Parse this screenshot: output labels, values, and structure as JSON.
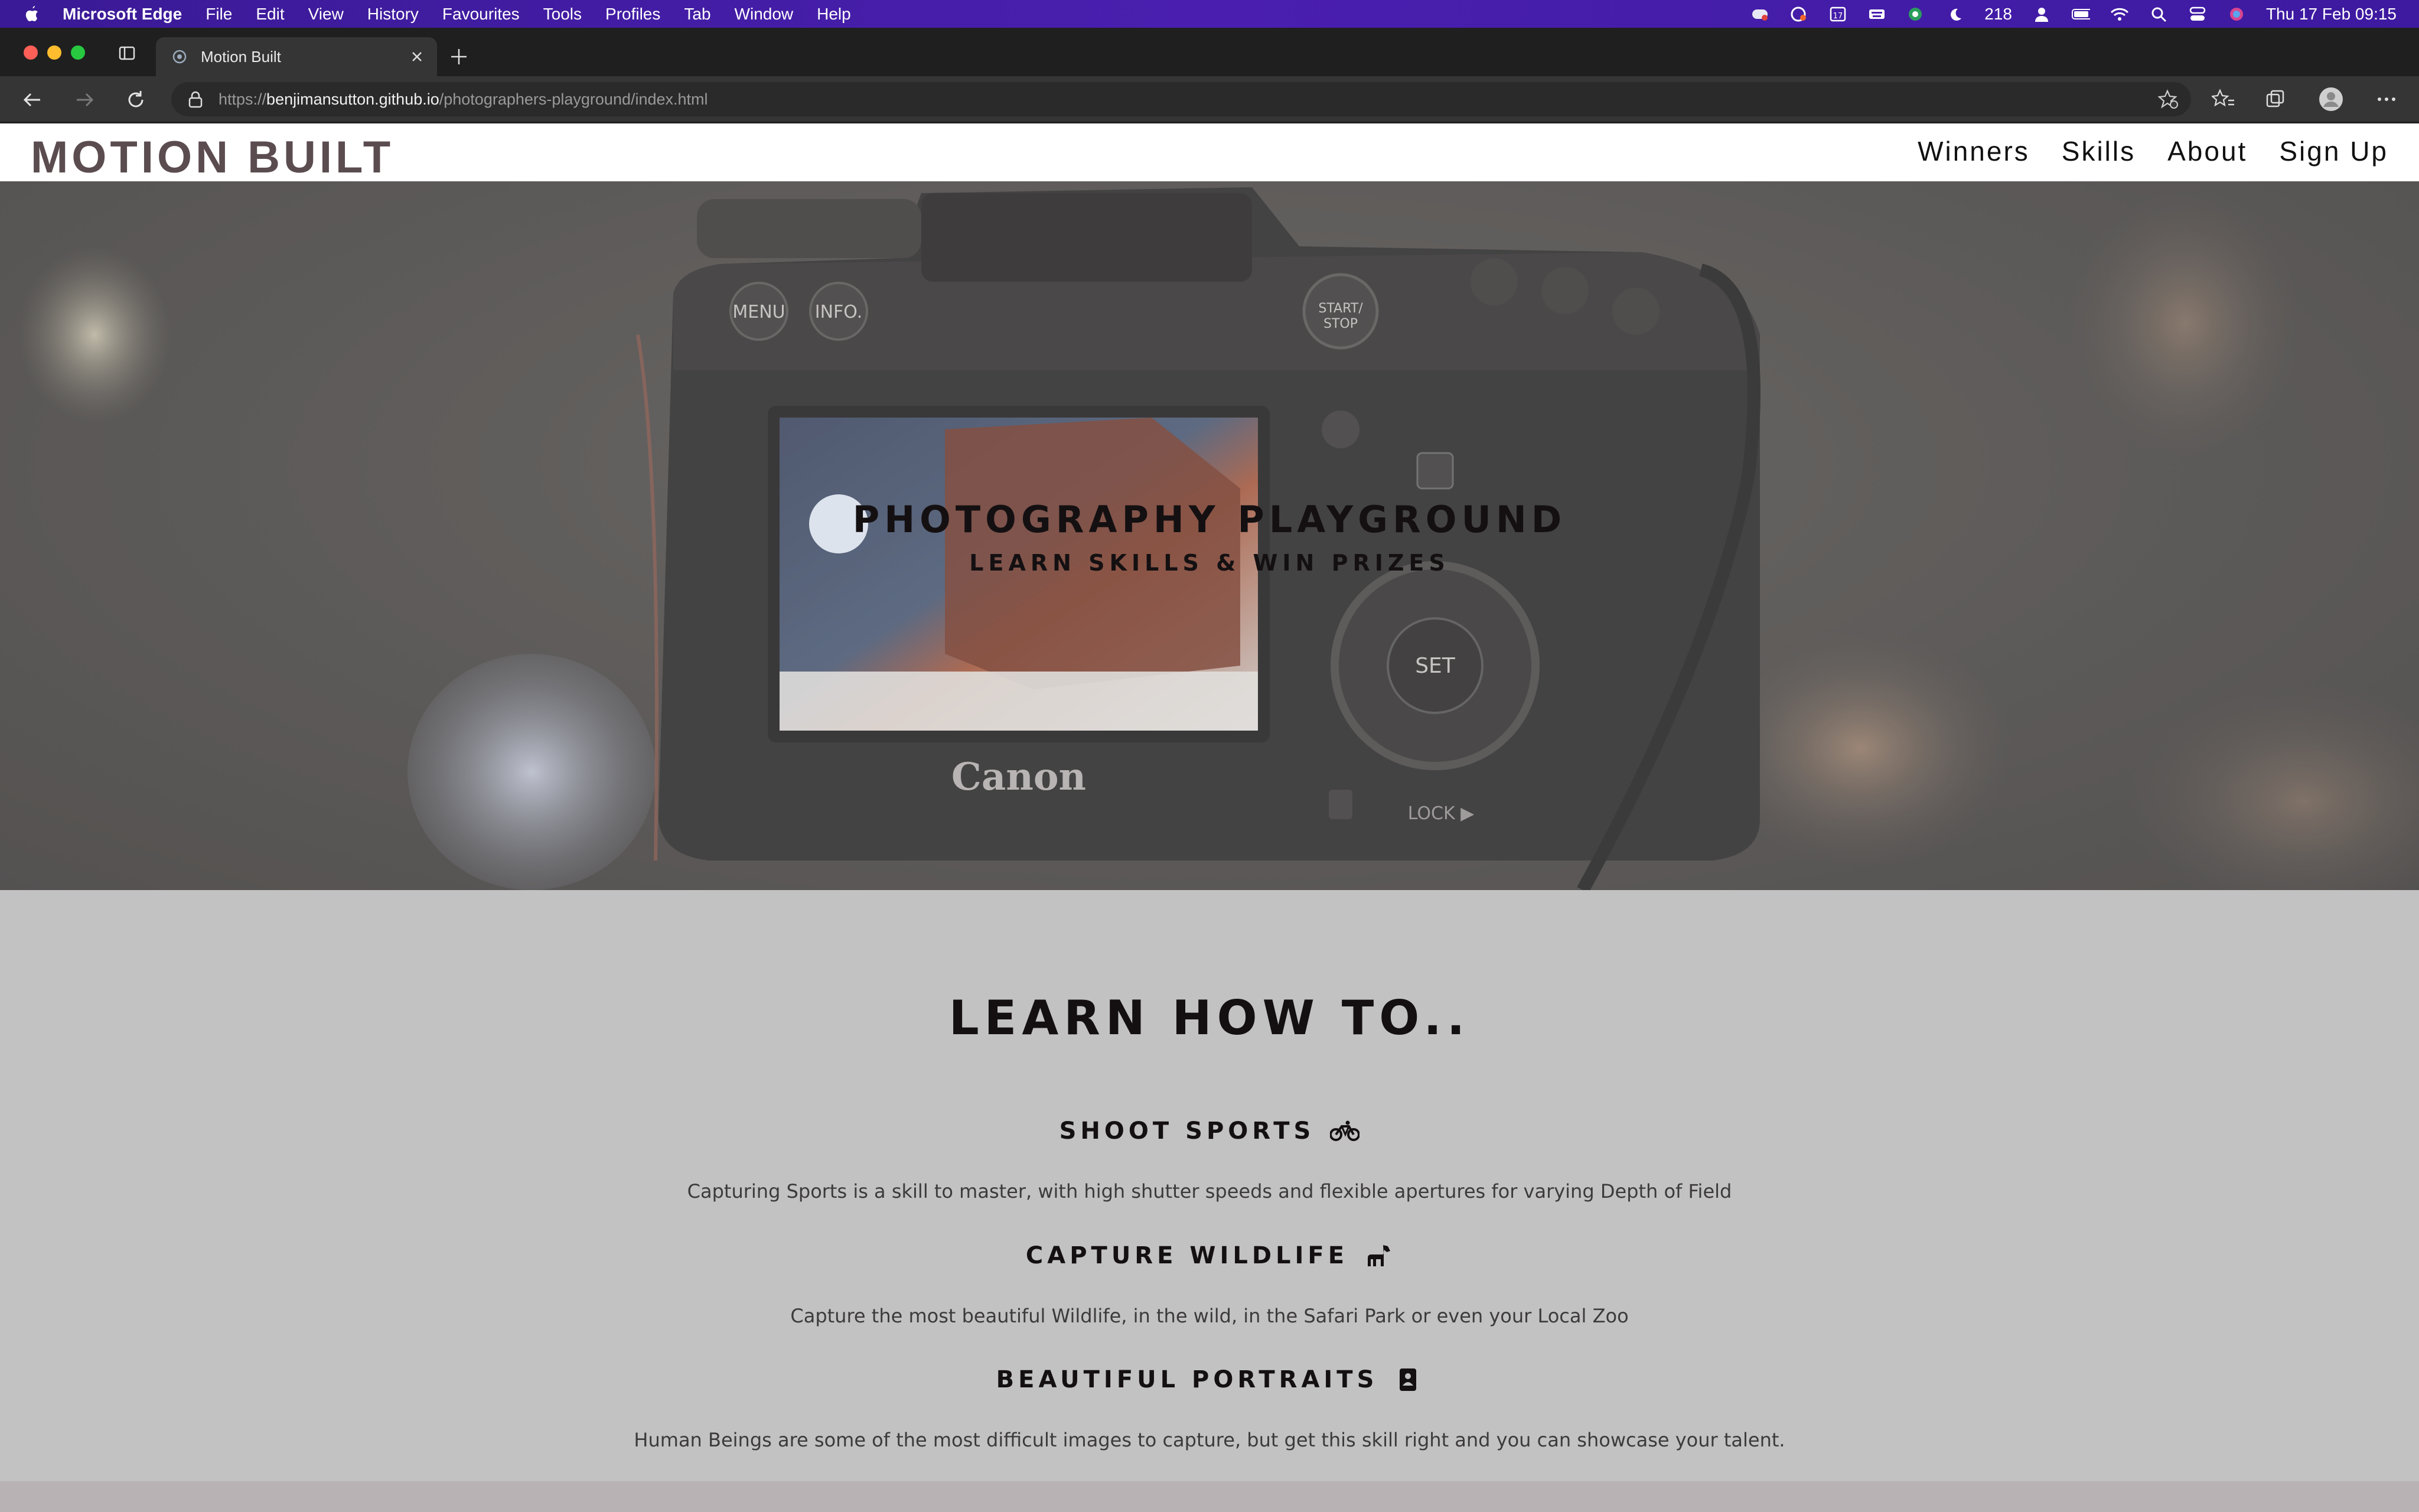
{
  "menubar": {
    "app_name": "Microsoft Edge",
    "items": [
      "File",
      "Edit",
      "View",
      "History",
      "Favourites",
      "Tools",
      "Profiles",
      "Tab",
      "Window",
      "Help"
    ],
    "battery_moon_count": "218",
    "datetime": "Thu 17 Feb  09:15"
  },
  "browser": {
    "tab_title": "Motion Built",
    "url_scheme": "https://",
    "url_host": "benjimansutton.github.io",
    "url_path": "/photographers-playground/index.html"
  },
  "site": {
    "brand": "MOTION BUILT",
    "nav": [
      "Winners",
      "Skills",
      "About",
      "Sign Up"
    ],
    "hero": {
      "title": "PHOTOGRAPHY PLAYGROUND",
      "subtitle": "LEARN SKILLS & WIN PRIZES",
      "camera_labels": {
        "menu": "MENU",
        "info": "INFO.",
        "set": "SET",
        "brand": "Canon",
        "start_stop": "START/ STOP",
        "lock": "LOCK ▶"
      }
    },
    "learn": {
      "title": "LEARN HOW TO..",
      "skills": [
        {
          "heading": "SHOOT SPORTS",
          "icon": "bicycle-icon",
          "description": "Capturing Sports is a skill to master, with high shutter speeds and flexible apertures for varying Depth of Field"
        },
        {
          "heading": "CAPTURE WILDLIFE",
          "icon": "horse-icon",
          "description": "Capture the most beautiful Wildlife, in the wild, in the Safari Park or even your Local Zoo"
        },
        {
          "heading": "BEAUTIFUL PORTRAITS",
          "icon": "portrait-icon",
          "description": "Human Beings are some of the most difficult images to capture, but get this skill right and you can showcase your talent."
        }
      ]
    }
  }
}
